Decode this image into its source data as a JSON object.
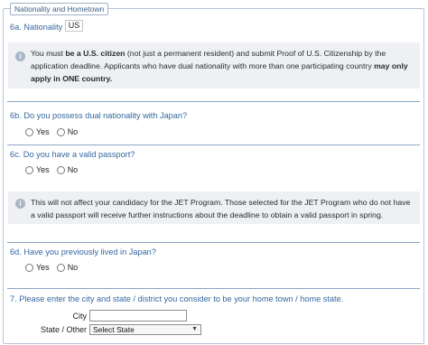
{
  "section": {
    "legend": "Nationality and Hometown"
  },
  "q6a": {
    "label": "6a. Nationality",
    "value": "US"
  },
  "info1": {
    "seg1": "You must ",
    "bold1": "be a U.S. citizen",
    "seg2": " (not just a permanent resident) and submit Proof of U.S. Citizenship by the application deadline. Applicants who have dual nationality with more than one participating country ",
    "bold2": "may only apply in ONE country."
  },
  "q6b": {
    "label": "6b. Do you possess dual nationality with Japan?",
    "yes": "Yes",
    "no": "No"
  },
  "q6c": {
    "label": "6c. Do you have a valid passport?",
    "yes": "Yes",
    "no": "No"
  },
  "info2": {
    "text": "This will not affect your candidacy for the JET Program. Those selected for the JET Program who do not have a valid passport will receive further instructions about the deadline to obtain a valid passport in spring."
  },
  "q6d": {
    "label": "6d. Have you previously lived in Japan?",
    "yes": "Yes",
    "no": "No"
  },
  "q7": {
    "label": "7. Please enter the city and state / district you consider to be your home town / home state.",
    "city_label": "City",
    "city_value": "",
    "state_label": "State / Other",
    "state_selected": "Select State"
  },
  "icons": {
    "info": "info-icon",
    "dropdown": "chevron-down-icon"
  },
  "colors": {
    "question": "#3568a0",
    "separator": "#8aa6c6",
    "info_bg": "#eef0f3"
  }
}
